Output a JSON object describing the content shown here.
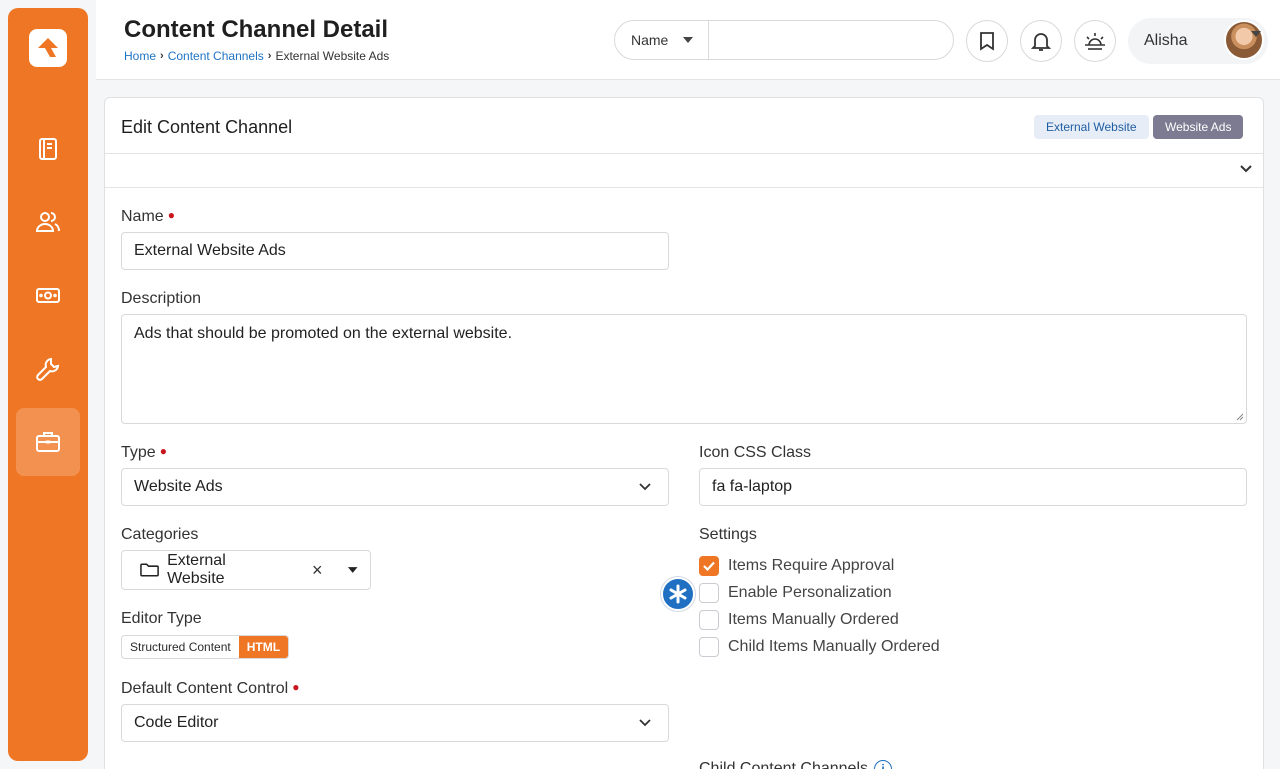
{
  "sidebar": {
    "items": [
      {
        "icon": "book-icon"
      },
      {
        "icon": "people-icon"
      },
      {
        "icon": "money-icon"
      },
      {
        "icon": "wrench-icon"
      },
      {
        "icon": "briefcase-icon",
        "active": true
      }
    ]
  },
  "header": {
    "title": "Content Channel Detail",
    "breadcrumb": [
      "Home",
      "Content Channels",
      "External Website Ads"
    ],
    "search": {
      "type_label": "Name",
      "value": ""
    },
    "user": {
      "name": "Alisha"
    }
  },
  "panel": {
    "title": "Edit Content Channel",
    "tags": [
      "External Website",
      "Website Ads"
    ]
  },
  "form": {
    "name": {
      "label": "Name",
      "value": "External Website Ads"
    },
    "description": {
      "label": "Description",
      "value": "Ads that should be promoted on the external website."
    },
    "type": {
      "label": "Type",
      "value": "Website Ads"
    },
    "icon_css": {
      "label": "Icon CSS Class",
      "value": "fa fa-laptop"
    },
    "categories": {
      "label": "Categories",
      "chip": "External Website"
    },
    "editor_type": {
      "label": "Editor Type",
      "options": [
        "Structured Content",
        "HTML"
      ],
      "selected": "HTML"
    },
    "settings": {
      "label": "Settings",
      "items": [
        {
          "label": "Items Require Approval",
          "checked": true
        },
        {
          "label": "Enable Personalization",
          "checked": false
        },
        {
          "label": "Items Manually Ordered",
          "checked": false
        },
        {
          "label": "Child Items Manually Ordered",
          "checked": false
        }
      ]
    },
    "default_control": {
      "label": "Default Content Control",
      "value": "Code Editor"
    },
    "child_channels": {
      "label": "Child Content Channels"
    }
  },
  "colors": {
    "accent": "#ee7624",
    "link": "#1f74c4",
    "required": "#c9151d"
  }
}
